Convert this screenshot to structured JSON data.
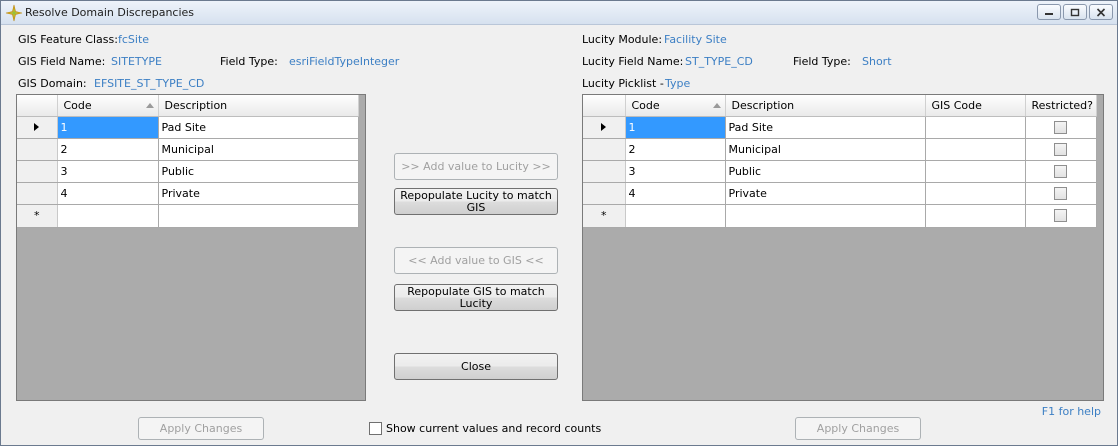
{
  "window": {
    "title": "Resolve Domain Discrepancies"
  },
  "gis": {
    "feature_class_label": "GIS Feature Class:",
    "feature_class": "fcSite",
    "field_name_label": "GIS Field Name:",
    "field_name": "SITETYPE",
    "field_type_label": "Field Type:",
    "field_type": "esriFieldTypeInteger",
    "domain_label": "GIS Domain:",
    "domain": "EFSITE_ST_TYPE_CD",
    "columns": [
      "Code",
      "Description"
    ],
    "rows": [
      {
        "code": "1",
        "description": "Pad Site"
      },
      {
        "code": "2",
        "description": "Municipal"
      },
      {
        "code": "3",
        "description": "Public"
      },
      {
        "code": "4",
        "description": "Private"
      }
    ],
    "new_row_marker": "*",
    "apply_label": "Apply Changes"
  },
  "lucity": {
    "module_label": "Lucity Module:",
    "module": "Facility Site",
    "field_name_label": "Lucity Field Name:",
    "field_name": "ST_TYPE_CD",
    "field_type_label": "Field Type:",
    "field_type": "Short",
    "picklist_label": "Lucity Picklist -",
    "picklist": "Type",
    "columns": [
      "Code",
      "Description",
      "GIS Code",
      "Restricted?"
    ],
    "rows": [
      {
        "code": "1",
        "description": "Pad Site",
        "gis_code": "",
        "restricted": false
      },
      {
        "code": "2",
        "description": "Municipal",
        "gis_code": "",
        "restricted": false
      },
      {
        "code": "3",
        "description": "Public",
        "gis_code": "",
        "restricted": false
      },
      {
        "code": "4",
        "description": "Private",
        "gis_code": "",
        "restricted": false
      }
    ],
    "new_row_marker": "*",
    "apply_label": "Apply Changes"
  },
  "actions": {
    "add_to_lucity": ">> Add value to Lucity >>",
    "repopulate_lucity_line1": "Repopulate Lucity to match",
    "repopulate_lucity_line2": "GIS",
    "add_to_gis": "<< Add value to GIS <<",
    "repopulate_gis_line1": "Repopulate GIS to match",
    "repopulate_gis_line2": "Lucity",
    "close": "Close"
  },
  "footer": {
    "show_counts_label": "Show current values and record counts",
    "show_counts_checked": false,
    "help": "F1 for help"
  },
  "colors": {
    "link_blue": "#3c7fc4",
    "selection": "#3399ff",
    "grid_bg": "#ababab"
  }
}
